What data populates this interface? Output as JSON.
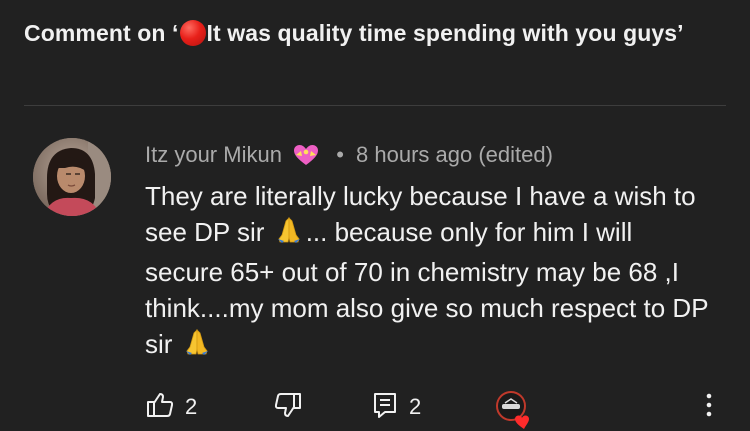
{
  "header": {
    "prefix": "Comment on ‘",
    "title_text": "It was quality time spending with you guys’"
  },
  "comment": {
    "author": "Itz your Mikun",
    "author_emoji": "heart-with-ribbon",
    "separator": "•",
    "time": "8 hours ago (edited)",
    "text_part1": "They are literally lucky because I have a wish to see DP sir ",
    "text_part2": "... because only for him I will secure 65+ out of 70 in chemistry may be 68 ,I think....my mom also give so much respect to DP sir ",
    "emoji": "folded-hands"
  },
  "actions": {
    "likes": "2",
    "replies": "2"
  },
  "colors": {
    "background": "#212121",
    "text_primary": "#f1f1f1",
    "text_secondary": "#aaaaaa",
    "live_dot": "#e8201a"
  }
}
